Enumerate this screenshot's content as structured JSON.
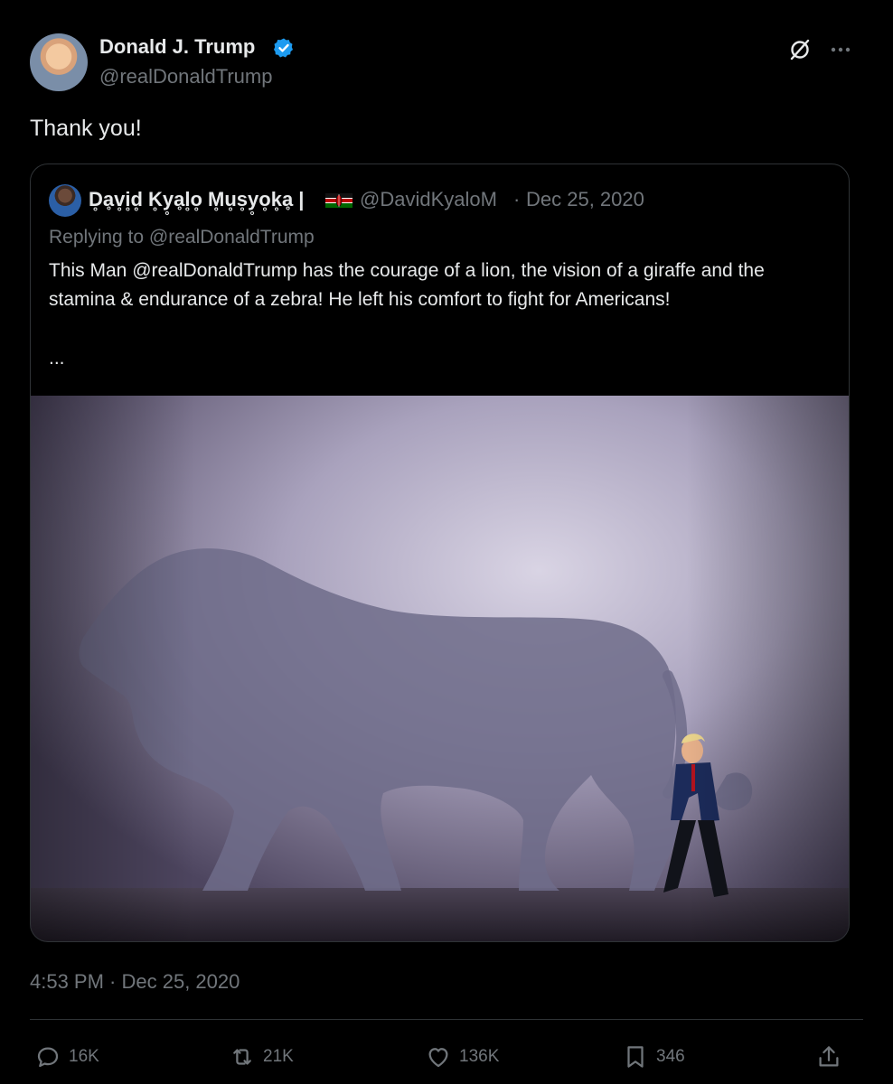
{
  "author": {
    "display_name": "Donald J. Trump",
    "handle": "@realDonaldTrump",
    "verified_icon": "verified-badge-icon"
  },
  "tweet": {
    "text": "Thank you!",
    "timestamp_time": "4:53 PM",
    "timestamp_sep": " · ",
    "timestamp_date": "Dec 25, 2020"
  },
  "header_icons": [
    "grok-icon",
    "more-icon"
  ],
  "quote": {
    "display_name": "D̥ḁv̥i̥d̥ K̥y̥ḁl̥o̥ M̥u̥s̥y̥o̥k̥ḁ |",
    "flag_icon": "kenya-flag-icon",
    "handle": "@DavidKyaloM",
    "separator": "·",
    "date": "Dec 25, 2020",
    "replying_to": "Replying to @realDonaldTrump",
    "text": "This Man @realDonaldTrump has the courage of a lion, the vision of a giraffe and the stamina & endurance of a zebra! He left his comfort to fight for Americans!",
    "ellipsis": "..."
  },
  "actions": {
    "replies": "16K",
    "reposts": "21K",
    "likes": "136K",
    "bookmarks": "346"
  },
  "colors": {
    "background": "#000000",
    "text": "#e7e9ea",
    "secondary": "#71767b",
    "border": "#2f3336",
    "verified": "#1d9bf0"
  }
}
